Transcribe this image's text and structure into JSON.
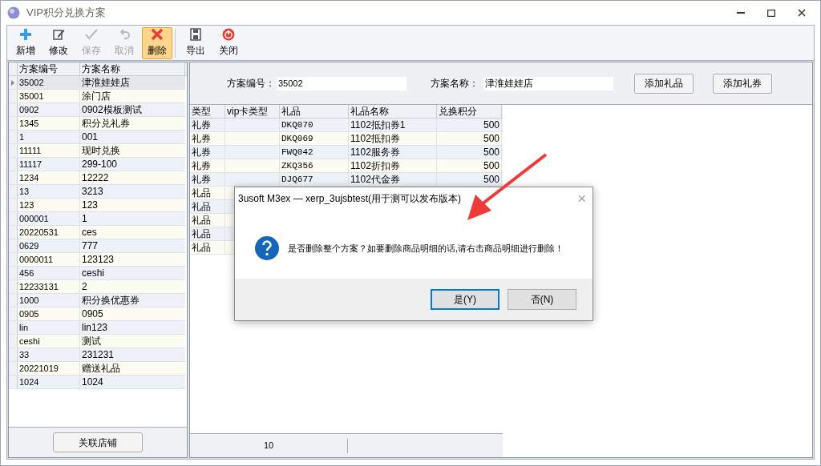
{
  "window": {
    "title": "VIP积分兑换方案"
  },
  "toolbar": [
    {
      "label": "新增",
      "kind": "add",
      "disabled": false,
      "selected": false
    },
    {
      "label": "修改",
      "kind": "edit",
      "disabled": false,
      "selected": false
    },
    {
      "label": "保存",
      "kind": "save",
      "disabled": true,
      "selected": false
    },
    {
      "label": "取消",
      "kind": "undo",
      "disabled": true,
      "selected": false
    },
    {
      "label": "删除",
      "kind": "delete",
      "disabled": false,
      "selected": true
    },
    {
      "label": "导出",
      "kind": "export",
      "disabled": false,
      "selected": false
    },
    {
      "label": "关闭",
      "kind": "close",
      "disabled": false,
      "selected": false
    }
  ],
  "plan_list": {
    "columns": [
      "方案编号",
      "方案名称"
    ],
    "rows": [
      {
        "code": "35002",
        "name": "津淮娃娃店",
        "selected": true
      },
      {
        "code": "35001",
        "name": "涂门店",
        "selected": false
      },
      {
        "code": "0902",
        "name": "0902模板测试",
        "selected": false
      },
      {
        "code": "1345",
        "name": "积分兑礼券",
        "selected": false
      },
      {
        "code": "1",
        "name": "001",
        "selected": false
      },
      {
        "code": "11111",
        "name": "现时兑换",
        "selected": false
      },
      {
        "code": "11117",
        "name": "299-100",
        "selected": false
      },
      {
        "code": "1234",
        "name": "12222",
        "selected": false
      },
      {
        "code": "13",
        "name": "3213",
        "selected": false
      },
      {
        "code": "123",
        "name": "123",
        "selected": false
      },
      {
        "code": "000001",
        "name": "1",
        "selected": false
      },
      {
        "code": "20220531",
        "name": "ces",
        "selected": false
      },
      {
        "code": "0629",
        "name": "777",
        "selected": false
      },
      {
        "code": "0000011",
        "name": "123123",
        "selected": false
      },
      {
        "code": "456",
        "name": "ceshi",
        "selected": false
      },
      {
        "code": "12233131",
        "name": "2",
        "selected": false
      },
      {
        "code": "1000",
        "name": "积分换优惠券",
        "selected": false
      },
      {
        "code": "0905",
        "name": "0905",
        "selected": false
      },
      {
        "code": "lin",
        "name": "lin123",
        "selected": false
      },
      {
        "code": "ceshi",
        "name": "测试",
        "selected": false
      },
      {
        "code": "33",
        "name": "231231",
        "selected": false
      },
      {
        "code": "20221019",
        "name": "赠送礼品",
        "selected": false
      },
      {
        "code": "1024",
        "name": "1024",
        "selected": false
      }
    ],
    "button": "关联店铺"
  },
  "form": {
    "code_label": "方案编号：",
    "code_value": "35002",
    "name_label": "方案名称：",
    "name_value": "津淮娃娃店",
    "buttons": [
      "添加礼品",
      "添加礼券"
    ]
  },
  "detail": {
    "columns": [
      "类型",
      "vip卡类型",
      "礼品",
      "礼品名称",
      "兑换积分"
    ],
    "rows": [
      {
        "type": "礼券",
        "card_type": "",
        "gift": "DKQ070",
        "gift_name": "1102抵扣券1",
        "points": "500"
      },
      {
        "type": "礼券",
        "card_type": "",
        "gift": "DKQ069",
        "gift_name": "1102抵扣券",
        "points": "500"
      },
      {
        "type": "礼券",
        "card_type": "",
        "gift": "FWQ042",
        "gift_name": "1102服务券",
        "points": "500"
      },
      {
        "type": "礼券",
        "card_type": "",
        "gift": "ZKQ356",
        "gift_name": "1102折扣券",
        "points": "500"
      },
      {
        "type": "礼券",
        "card_type": "",
        "gift": "DJQ677",
        "gift_name": "1102代金券",
        "points": "500"
      },
      {
        "type": "礼品"
      },
      {
        "type": "礼品"
      },
      {
        "type": "礼品"
      },
      {
        "type": "礼品"
      },
      {
        "type": "礼品"
      }
    ],
    "footer_count": "10"
  },
  "dialog": {
    "title": "3usoft M3ex — xerp_3ujsbtest(用于测可以发布版本)",
    "close": "×",
    "message": "是否删除整个方案？如要删除商品明细的话,请右击商品明细进行删除！",
    "buttons": [
      {
        "label": "是(Y)",
        "selected": true
      },
      {
        "label": "否(N)",
        "selected": false
      }
    ]
  }
}
